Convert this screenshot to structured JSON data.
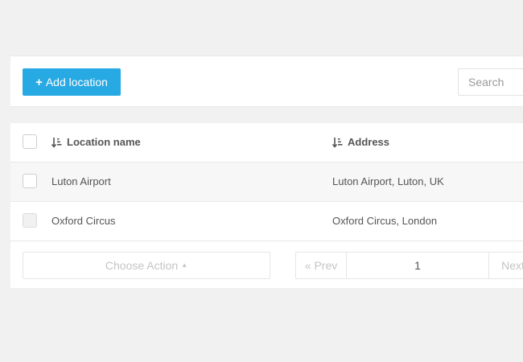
{
  "toolbar": {
    "add_label": "Add location",
    "search_placeholder": "Search"
  },
  "table": {
    "columns": [
      {
        "label": "Location name",
        "sort_icon": "sort-amount-asc-icon"
      },
      {
        "label": "Address",
        "sort_icon": "sort-amount-asc-icon"
      }
    ],
    "rows": [
      {
        "name": "Luton Airport",
        "address": "Luton Airport, Luton, UK"
      },
      {
        "name": "Oxford Circus",
        "address": "Oxford Circus, London"
      }
    ]
  },
  "footer": {
    "action_label": "Choose Action",
    "prev_label": "« Prev",
    "page_value": "1",
    "next_label": "Next"
  },
  "colors": {
    "accent": "#27a9e3",
    "background": "#f1f1f1"
  }
}
